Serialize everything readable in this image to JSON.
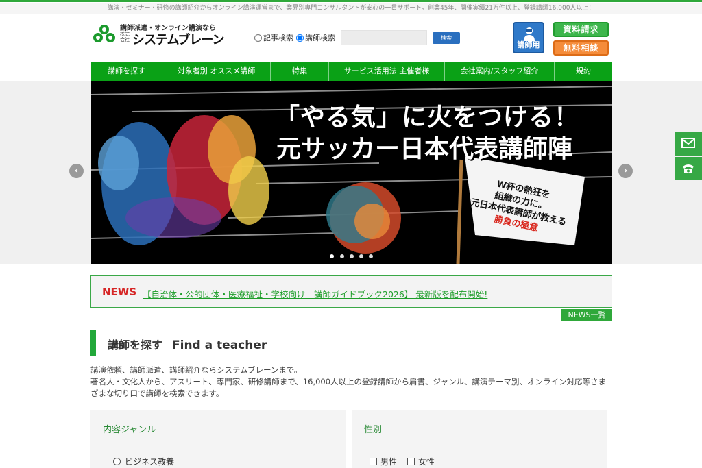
{
  "tagline": "講演・セミナー・研修の講師紹介からオンライン講演運営まで、業界別専門コンサルタントが安心の一貫サポート。創業45年、開催実績21万件以上、登録講師16,000人以上！",
  "logo": {
    "catch": "講師派遣・オンライン講演なら",
    "kabushiki": "株式会社",
    "name": "システムブレーン"
  },
  "search": {
    "option_articles": "記事検索",
    "option_lecturers": "講師検索",
    "button": "検索",
    "placeholder": ""
  },
  "header_buttons": {
    "lecturer": "講師用",
    "documents": "資料請求",
    "consult": "無料相談"
  },
  "nav": [
    "講師を探す",
    "対象者別 オススメ講師",
    "特集",
    "サービス活用法 主催者様",
    "会社案内/スタッフ紹介",
    "規約"
  ],
  "hero": {
    "title1": "「やる気」に火をつける！",
    "title2": "元サッカー日本代表講師陣",
    "flag_lines": [
      "W杯の熱狂を",
      "組織の力に。",
      "元日本代表講師が教える"
    ],
    "flag_red": "勝負の極意",
    "slide_count": 5
  },
  "news": {
    "label": "NEWS",
    "headline": "【自治体・公的団体・医療福祉・学校向け　講師ガイドブック2026】 最新版を配布開始!",
    "list_button": "NEWS一覧"
  },
  "section": {
    "title_ja": "講師を探す",
    "title_en": "Find a teacher",
    "intro_line1": "講演依頼、講師派遣、講師紹介ならシステムブレーンまで。",
    "intro_line2": "著名人・文化人から、アスリート、専門家、研修講師まで、16,000人以上の登録講師から肩書、ジャンル、講演テーマ別、オンライン対応等さまざまな切り口で講師を検索できます。"
  },
  "filters": {
    "genre_title": "内容ジャンル",
    "genre_first_option": "ビジネス教養",
    "gender_title": "性別",
    "gender_male": "男性",
    "gender_female": "女性"
  },
  "colors": {
    "brand_green": "#0aa116",
    "news_red": "#d62525",
    "consult_orange": "#f58c3a",
    "lecturer_blue": "#2f79c9"
  }
}
